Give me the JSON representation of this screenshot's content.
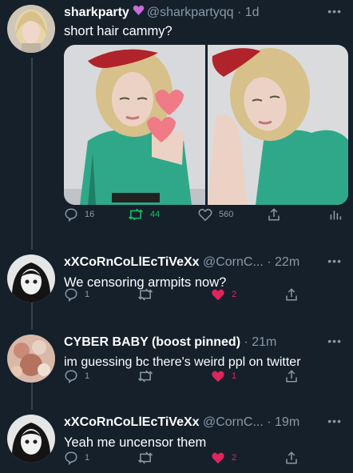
{
  "tweets": [
    {
      "name": "sharkparty",
      "handle": "@sharkpartyqq",
      "time": "1d",
      "text": "short hair cammy?",
      "replies": "16",
      "retweets": "44",
      "likes": "560"
    },
    {
      "name": "xXCoRnCoLlEcTiVeXx",
      "handle": "@CornC...",
      "time": "22m",
      "text": "We censoring armpits now?",
      "replies": "1",
      "likes": "2"
    },
    {
      "name": "CYBER BABY (boost pinned)",
      "handle": "",
      "time": "21m",
      "text": "im guessing bc there's weird ppl on twitter",
      "replies": "1",
      "likes": "1"
    },
    {
      "name": "xXCoRnCoLlEcTiVeXx",
      "handle": "@CornC...",
      "time": "19m",
      "text": "Yeah me uncensor them",
      "replies": "1",
      "likes": "2"
    }
  ],
  "colors": {
    "background": "#15202b",
    "secondary_text": "#8899a6",
    "like_red": "#e0245e",
    "heart_badge": "#c66bd9"
  }
}
